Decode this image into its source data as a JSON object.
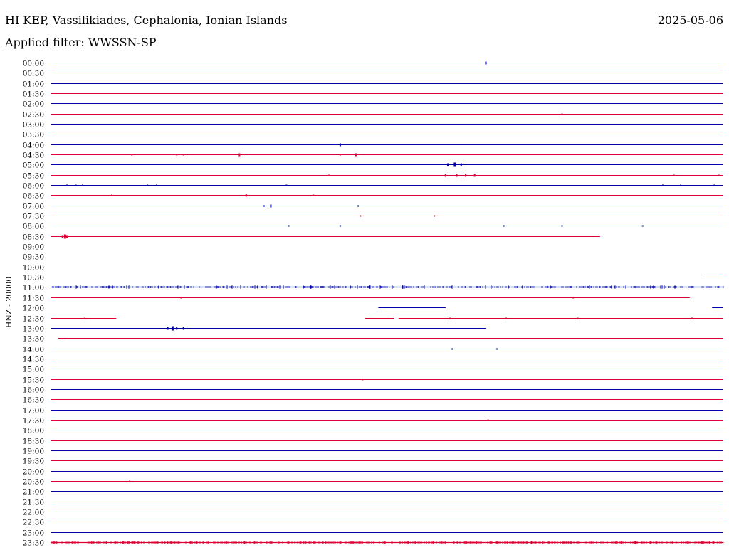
{
  "header": {
    "title": "HI KEP, Vassilikiades, Cephalonia, Ionian Islands",
    "date": "2025-05-06",
    "filter": "Applied filter: WWSSN-SP"
  },
  "axis": {
    "ylabel": "HNZ - 20000"
  },
  "colors": {
    "even_line": "#0000aa",
    "odd_line": "#dd0033",
    "label": "#000000"
  },
  "chart_data": {
    "type": "line",
    "title": "HI KEP, Vassilikiades, Cephalonia, Ionian Islands",
    "subtitle": "Applied filter: WWSSN-SP",
    "ylabel": "HNZ - 20000",
    "xlabel": "",
    "x_unit": "minutes past the start of each trace row",
    "x_range": [
      0,
      30
    ],
    "grid": false,
    "legend": "none",
    "rows": [
      {
        "label": "00:00",
        "color": "blue",
        "segments": [
          [
            0,
            30
          ]
        ],
        "events": [
          {
            "x": 19.4,
            "a": 2
          }
        ]
      },
      {
        "label": "00:30",
        "color": "red",
        "segments": [
          [
            0,
            30
          ]
        ],
        "events": []
      },
      {
        "label": "01:00",
        "color": "blue",
        "segments": [
          [
            0,
            30
          ]
        ],
        "events": []
      },
      {
        "label": "01:30",
        "color": "red",
        "segments": [
          [
            0,
            30
          ]
        ],
        "events": []
      },
      {
        "label": "02:00",
        "color": "blue",
        "segments": [
          [
            0,
            30
          ]
        ],
        "events": []
      },
      {
        "label": "02:30",
        "color": "red",
        "segments": [
          [
            0,
            30
          ]
        ],
        "events": [
          {
            "x": 22.8,
            "a": 1
          }
        ]
      },
      {
        "label": "03:00",
        "color": "blue",
        "segments": [
          [
            0,
            30
          ]
        ],
        "events": []
      },
      {
        "label": "03:30",
        "color": "red",
        "segments": [
          [
            0,
            30
          ]
        ],
        "events": []
      },
      {
        "label": "04:00",
        "color": "blue",
        "segments": [
          [
            0,
            30
          ]
        ],
        "events": [
          {
            "x": 12.9,
            "a": 2
          }
        ]
      },
      {
        "label": "04:30",
        "color": "red",
        "segments": [
          [
            0,
            30
          ]
        ],
        "events": [
          {
            "x": 3.6,
            "a": 1
          },
          {
            "x": 5.6,
            "a": 1
          },
          {
            "x": 5.9,
            "a": 1
          },
          {
            "x": 8.4,
            "a": 2
          },
          {
            "x": 12.9,
            "a": 1
          },
          {
            "x": 13.6,
            "a": 2
          }
        ]
      },
      {
        "label": "05:00",
        "color": "blue",
        "segments": [
          [
            0,
            30
          ]
        ],
        "events": [
          {
            "x": 17.7,
            "a": 2
          },
          {
            "x": 18.0,
            "a": 3
          },
          {
            "x": 18.3,
            "a": 2
          }
        ]
      },
      {
        "label": "05:30",
        "color": "red",
        "segments": [
          [
            0,
            30
          ]
        ],
        "events": [
          {
            "x": 12.4,
            "a": 1
          },
          {
            "x": 17.6,
            "a": 2
          },
          {
            "x": 18.1,
            "a": 2
          },
          {
            "x": 18.5,
            "a": 2
          },
          {
            "x": 18.9,
            "a": 2
          },
          {
            "x": 27.8,
            "a": 1
          },
          {
            "x": 29.8,
            "a": 1
          }
        ]
      },
      {
        "label": "06:00",
        "color": "blue",
        "segments": [
          [
            0,
            30
          ]
        ],
        "events": [
          {
            "x": 0.7,
            "a": 1
          },
          {
            "x": 1.1,
            "a": 1
          },
          {
            "x": 1.4,
            "a": 1
          },
          {
            "x": 4.3,
            "a": 1
          },
          {
            "x": 4.7,
            "a": 1
          },
          {
            "x": 10.5,
            "a": 1
          },
          {
            "x": 27.3,
            "a": 1
          },
          {
            "x": 28.1,
            "a": 1
          },
          {
            "x": 29.6,
            "a": 1
          }
        ]
      },
      {
        "label": "06:30",
        "color": "red",
        "segments": [
          [
            0,
            30
          ]
        ],
        "events": [
          {
            "x": 2.7,
            "a": 1
          },
          {
            "x": 8.7,
            "a": 2
          },
          {
            "x": 11.7,
            "a": 1
          }
        ]
      },
      {
        "label": "07:00",
        "color": "blue",
        "segments": [
          [
            0,
            30
          ]
        ],
        "events": [
          {
            "x": 9.5,
            "a": 1
          },
          {
            "x": 9.8,
            "a": 2
          },
          {
            "x": 13.7,
            "a": 1
          }
        ]
      },
      {
        "label": "07:30",
        "color": "red",
        "segments": [
          [
            0,
            30
          ]
        ],
        "events": [
          {
            "x": 13.8,
            "a": 1
          },
          {
            "x": 17.1,
            "a": 1
          }
        ]
      },
      {
        "label": "08:00",
        "color": "blue",
        "segments": [
          [
            0,
            30
          ]
        ],
        "events": [
          {
            "x": 10.6,
            "a": 1
          },
          {
            "x": 12.9,
            "a": 1
          },
          {
            "x": 20.2,
            "a": 1
          },
          {
            "x": 22.8,
            "a": 1
          },
          {
            "x": 26.4,
            "a": 1
          }
        ]
      },
      {
        "label": "08:30",
        "color": "red",
        "segments": [
          [
            0,
            24.5
          ]
        ],
        "events": [
          {
            "x": 0.5,
            "a": 2
          },
          {
            "x": 0.6,
            "a": 3
          },
          {
            "x": 0.7,
            "a": 2
          }
        ]
      },
      {
        "label": "09:00",
        "color": "blue",
        "segments": [],
        "events": []
      },
      {
        "label": "09:30",
        "color": "red",
        "segments": [],
        "events": []
      },
      {
        "label": "10:00",
        "color": "blue",
        "segments": [],
        "events": []
      },
      {
        "label": "10:30",
        "color": "red",
        "segments": [
          [
            29.2,
            30
          ]
        ],
        "events": []
      },
      {
        "label": "11:00",
        "color": "blue",
        "segments": [
          [
            0,
            30
          ]
        ],
        "events": [],
        "noisy": true
      },
      {
        "label": "11:30",
        "color": "red",
        "segments": [
          [
            0,
            28.5
          ]
        ],
        "events": [
          {
            "x": 5.8,
            "a": 1
          },
          {
            "x": 23.3,
            "a": 1
          }
        ]
      },
      {
        "label": "12:00",
        "color": "blue",
        "segments": [
          [
            14.6,
            17.6
          ],
          [
            29.5,
            30
          ]
        ],
        "events": []
      },
      {
        "label": "12:30",
        "color": "red",
        "segments": [
          [
            0,
            2.9
          ],
          [
            14.0,
            15.3
          ],
          [
            15.5,
            30
          ]
        ],
        "events": [
          {
            "x": 1.5,
            "a": 1
          },
          {
            "x": 17.8,
            "a": 1
          },
          {
            "x": 20.3,
            "a": 1
          },
          {
            "x": 23.5,
            "a": 1
          },
          {
            "x": 28.6,
            "a": 1
          }
        ]
      },
      {
        "label": "13:00",
        "color": "blue",
        "segments": [
          [
            0,
            19.4
          ]
        ],
        "events": [
          {
            "x": 5.2,
            "a": 2
          },
          {
            "x": 5.4,
            "a": 3
          },
          {
            "x": 5.6,
            "a": 2
          },
          {
            "x": 5.9,
            "a": 2
          }
        ]
      },
      {
        "label": "13:30",
        "color": "red",
        "segments": [
          [
            0.3,
            30
          ]
        ],
        "events": []
      },
      {
        "label": "14:00",
        "color": "blue",
        "segments": [
          [
            0,
            30
          ]
        ],
        "events": [
          {
            "x": 17.9,
            "a": 1
          },
          {
            "x": 19.9,
            "a": 1
          }
        ]
      },
      {
        "label": "14:30",
        "color": "red",
        "segments": [
          [
            0,
            30
          ]
        ],
        "events": []
      },
      {
        "label": "15:00",
        "color": "blue",
        "segments": [
          [
            0,
            30
          ]
        ],
        "events": []
      },
      {
        "label": "15:30",
        "color": "red",
        "segments": [
          [
            0,
            30
          ]
        ],
        "events": [
          {
            "x": 13.9,
            "a": 1
          }
        ]
      },
      {
        "label": "16:00",
        "color": "blue",
        "segments": [
          [
            0,
            30
          ]
        ],
        "events": []
      },
      {
        "label": "16:30",
        "color": "red",
        "segments": [
          [
            0,
            30
          ]
        ],
        "events": []
      },
      {
        "label": "17:00",
        "color": "blue",
        "segments": [
          [
            0,
            30
          ]
        ],
        "events": []
      },
      {
        "label": "17:30",
        "color": "red",
        "segments": [
          [
            0,
            30
          ]
        ],
        "events": [
          {
            "x": 19.5,
            "a": 1
          }
        ]
      },
      {
        "label": "18:00",
        "color": "blue",
        "segments": [
          [
            0,
            30
          ]
        ],
        "events": []
      },
      {
        "label": "18:30",
        "color": "red",
        "segments": [
          [
            0,
            30
          ]
        ],
        "events": []
      },
      {
        "label": "19:00",
        "color": "blue",
        "segments": [
          [
            0,
            30
          ]
        ],
        "events": []
      },
      {
        "label": "19:30",
        "color": "red",
        "segments": [
          [
            0,
            30
          ]
        ],
        "events": []
      },
      {
        "label": "20:00",
        "color": "blue",
        "segments": [
          [
            0,
            30
          ]
        ],
        "events": []
      },
      {
        "label": "20:30",
        "color": "red",
        "segments": [
          [
            0,
            30
          ]
        ],
        "events": [
          {
            "x": 3.5,
            "a": 1
          }
        ]
      },
      {
        "label": "21:00",
        "color": "blue",
        "segments": [
          [
            0,
            30
          ]
        ],
        "events": []
      },
      {
        "label": "21:30",
        "color": "red",
        "segments": [
          [
            0,
            30
          ]
        ],
        "events": []
      },
      {
        "label": "22:00",
        "color": "blue",
        "segments": [
          [
            0,
            30
          ]
        ],
        "events": []
      },
      {
        "label": "22:30",
        "color": "red",
        "segments": [
          [
            0,
            30
          ]
        ],
        "events": []
      },
      {
        "label": "23:00",
        "color": "blue",
        "segments": [
          [
            0,
            30
          ]
        ],
        "events": []
      },
      {
        "label": "23:30",
        "color": "red",
        "segments": [
          [
            0,
            30
          ]
        ],
        "events": [],
        "noisy": true
      }
    ]
  }
}
